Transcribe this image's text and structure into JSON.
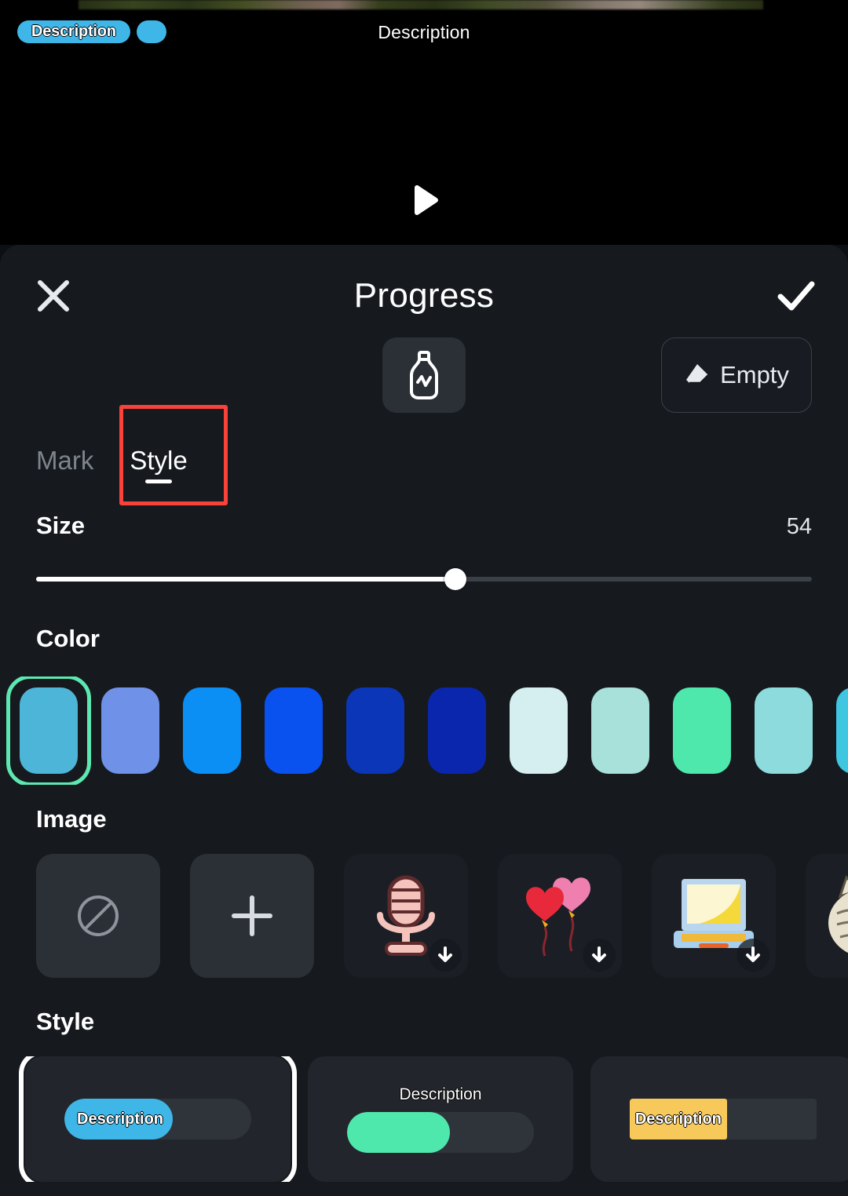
{
  "preview": {
    "overlay_badge_text": "Description",
    "overlay_center_text": "Description",
    "play_icon": "play-icon",
    "filmstrip_name": "video-filmstrip"
  },
  "sheet": {
    "title": "Progress",
    "close_icon": "close-icon",
    "confirm_icon": "checkmark-icon",
    "tools": {
      "bottle_icon": "bottle-icon",
      "empty_label": "Empty",
      "empty_icon": "eraser-icon"
    },
    "tabs": [
      {
        "label": "Mark",
        "active": false
      },
      {
        "label": "Style",
        "active": true
      }
    ],
    "highlight_target": "Style",
    "size": {
      "label": "Size",
      "value": "54",
      "percent": 54
    },
    "color": {
      "label": "Color",
      "selected_index": 0,
      "swatches": [
        {
          "name": "teal-cyan",
          "hex": "#4db6d8"
        },
        {
          "name": "periwinkle-blue",
          "hex": "#6f91e8"
        },
        {
          "name": "sky-blue",
          "hex": "#0b8ff5"
        },
        {
          "name": "bright-blue",
          "hex": "#0a52f0"
        },
        {
          "name": "deep-blue",
          "hex": "#0b36b8"
        },
        {
          "name": "navy-blue",
          "hex": "#0a26ad"
        },
        {
          "name": "pale-mint",
          "hex": "#d5eff0"
        },
        {
          "name": "light-aqua",
          "hex": "#a8e0da"
        },
        {
          "name": "spring-green",
          "hex": "#4ee8ad"
        },
        {
          "name": "soft-turquoise",
          "hex": "#8ddbdd"
        },
        {
          "name": "cyan-edge",
          "hex": "#3fc6e0"
        }
      ]
    },
    "image": {
      "label": "Image",
      "items": [
        {
          "name": "none-option",
          "type": "none",
          "downloadable": false
        },
        {
          "name": "add-image-option",
          "type": "add",
          "downloadable": false
        },
        {
          "name": "microphone-sticker",
          "type": "sticker",
          "downloadable": true
        },
        {
          "name": "heart-balloons-sticker",
          "type": "sticker",
          "downloadable": true
        },
        {
          "name": "laptop-sticker",
          "type": "sticker",
          "downloadable": true
        },
        {
          "name": "cat-sticker",
          "type": "sticker",
          "downloadable": false
        }
      ]
    },
    "style": {
      "label": "Style",
      "cards": [
        {
          "name": "style-pill-blue",
          "selected": true,
          "shape": "pill",
          "bar_color": "#3fb6e8",
          "fill_percent": 58,
          "text": "Description",
          "text_position": "inside"
        },
        {
          "name": "style-pill-green",
          "selected": false,
          "shape": "pill",
          "bar_color": "#4ee8ad",
          "fill_percent": 55,
          "text": "Description",
          "text_position": "above"
        },
        {
          "name": "style-square-yellow",
          "selected": false,
          "shape": "square",
          "bar_color": "#f7c95a",
          "fill_percent": 52,
          "text": "Description",
          "text_position": "inside"
        }
      ]
    }
  }
}
